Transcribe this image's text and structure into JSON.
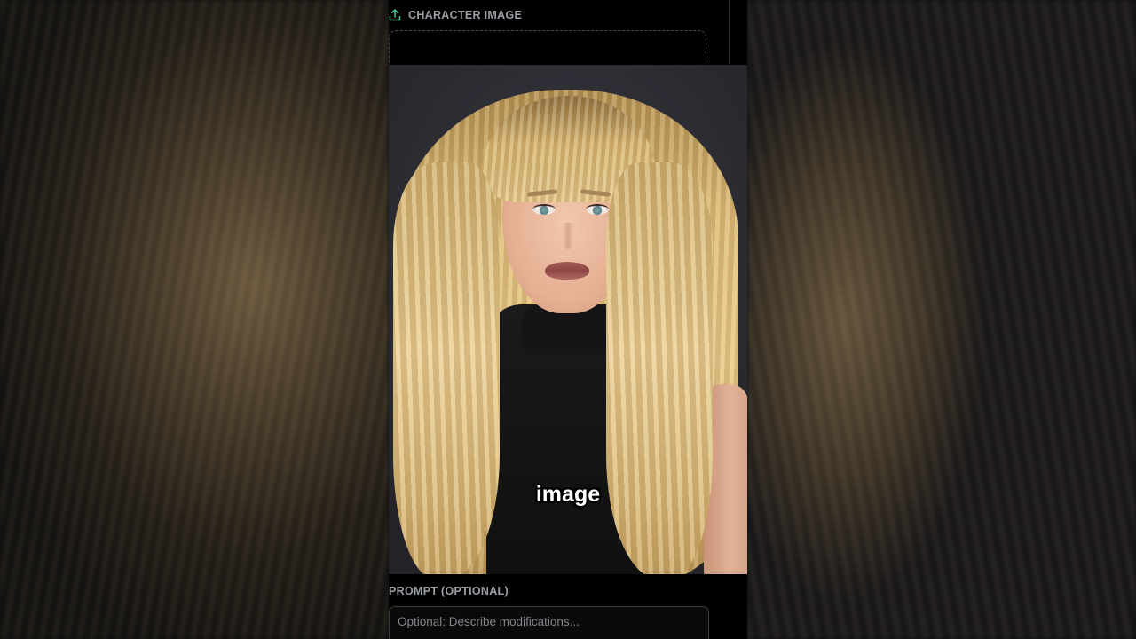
{
  "character_image": {
    "section_label": "CHARACTER IMAGE",
    "icon": "upload-icon"
  },
  "preview": {
    "caption": "image"
  },
  "prompt": {
    "label": "PROMPT (OPTIONAL)",
    "placeholder": "Optional: Describe modifications..."
  },
  "colors": {
    "accent": "#3fbf8f",
    "panel_bg": "#000000",
    "label_text": "#9aa0a6"
  }
}
